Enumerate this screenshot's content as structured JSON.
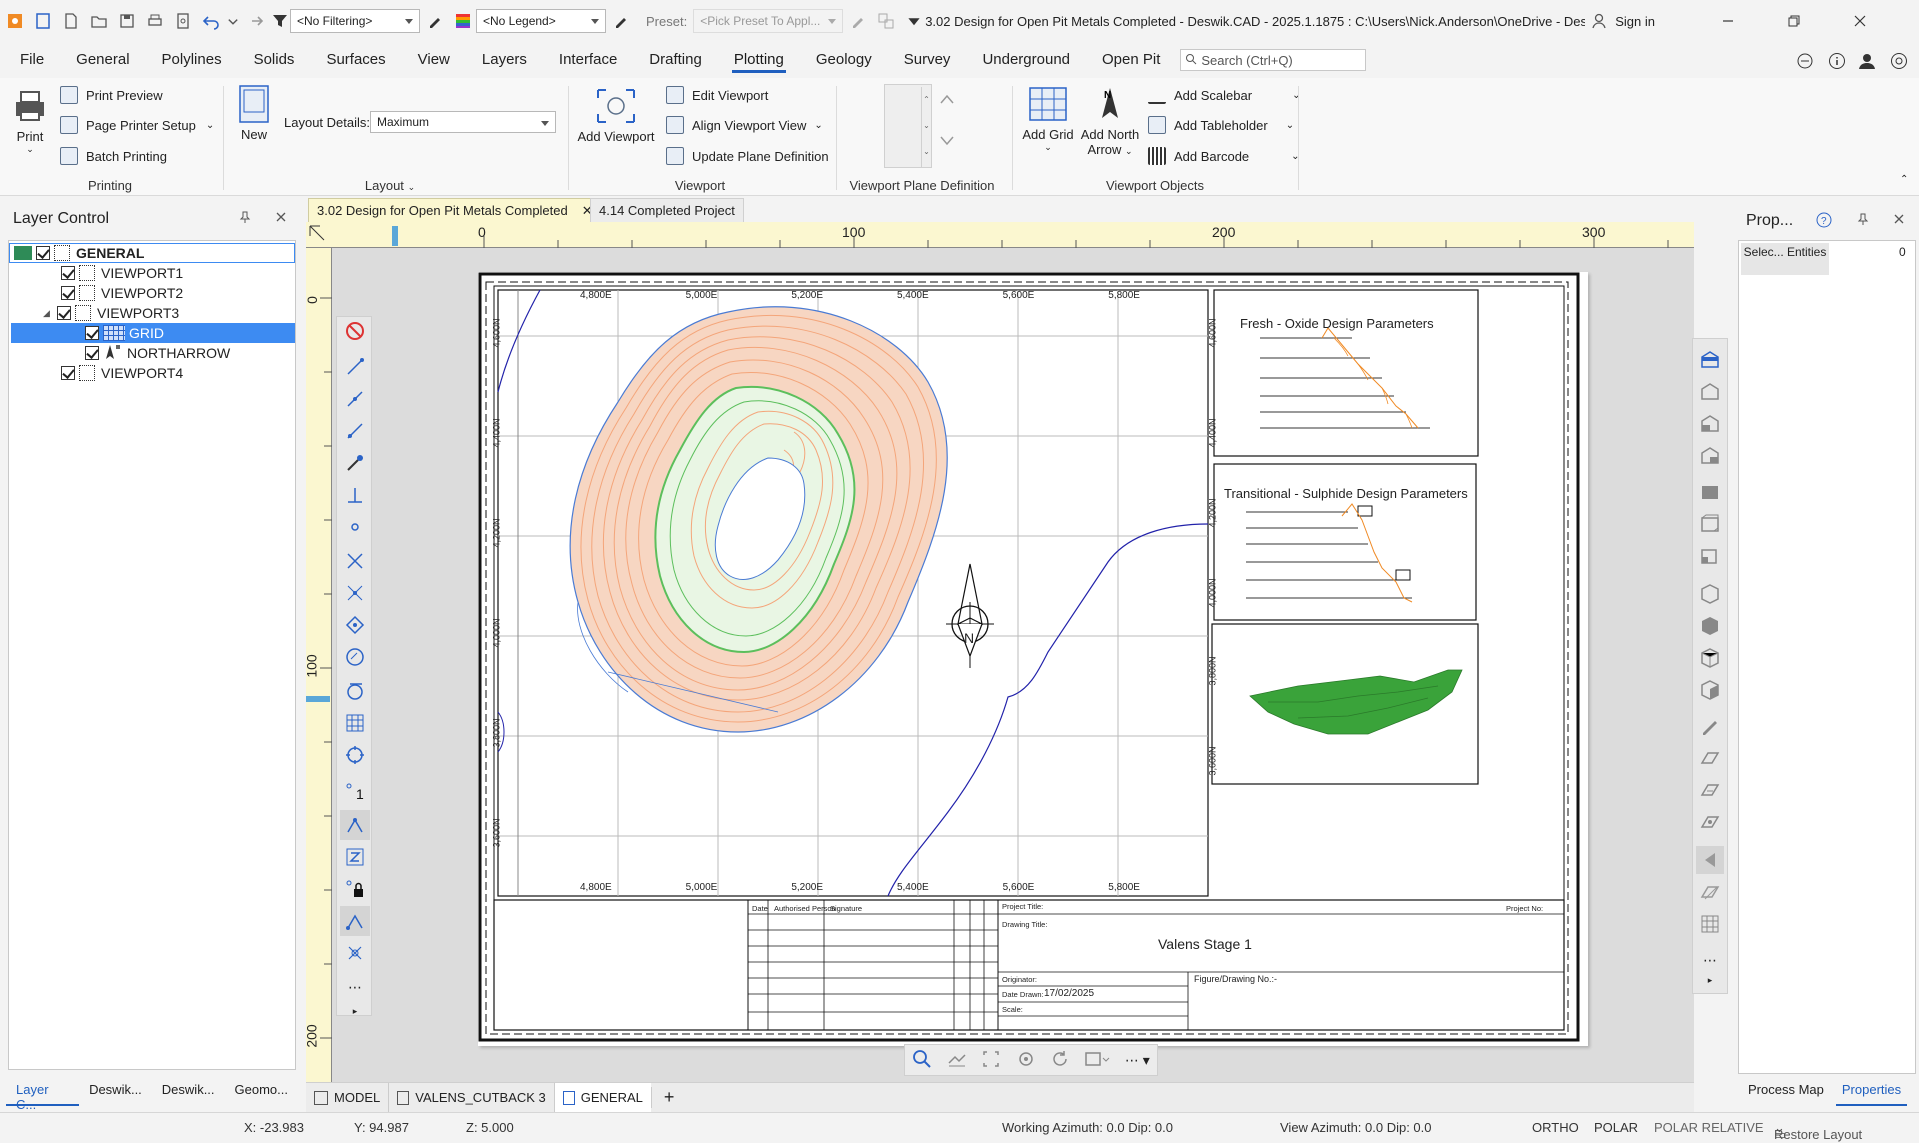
{
  "titlebar": {
    "filter": "<No Filtering>",
    "legend": "<No Legend>",
    "preset_label": "Preset:",
    "preset_value": "<Pick Preset To Appl...",
    "title": "3.02 Design for Open Pit Metals Completed - Deswik.CAD - 2025.1.1875 : C:\\Users\\Nick.Anderson\\OneDrive - Deswik...",
    "signin": "Sign in"
  },
  "menu": [
    "File",
    "General",
    "Polylines",
    "Solids",
    "Surfaces",
    "View",
    "Layers",
    "Interface",
    "Drafting",
    "Plotting",
    "Geology",
    "Survey",
    "Underground",
    "Open Pit"
  ],
  "menu_active": "Plotting",
  "search_placeholder": "Search (Ctrl+Q)",
  "ribbon": {
    "print": "Print",
    "print_preview": "Print Preview",
    "page_printer_setup": "Page Printer Setup",
    "batch_printing": "Batch Printing",
    "group_printing": "Printing",
    "new": "New",
    "layout_details_label": "Layout Details:",
    "layout_details_value": "Maximum",
    "group_layout": "Layout",
    "add_viewport": "Add Viewport",
    "edit_viewport": "Edit Viewport",
    "align_viewport_view": "Align Viewport View",
    "update_plane_definition": "Update Plane Definition",
    "group_viewport": "Viewport",
    "group_viewport_plane": "Viewport Plane Definition",
    "add_grid": "Add Grid",
    "add_north": "Add North",
    "arrow": "Arrow",
    "add_scalebar": "Add Scalebar",
    "add_tableholder": "Add Tableholder",
    "add_barcode": "Add Barcode",
    "group_viewport_objects": "Viewport Objects"
  },
  "layer_control": {
    "title": "Layer Control",
    "items": [
      {
        "label": "GENERAL",
        "level": 0,
        "bold": true
      },
      {
        "label": "VIEWPORT1",
        "level": 1
      },
      {
        "label": "VIEWPORT2",
        "level": 1
      },
      {
        "label": "VIEWPORT3",
        "level": 1
      },
      {
        "label": "GRID",
        "level": 2,
        "selected": true
      },
      {
        "label": "NORTHARROW",
        "level": 2
      },
      {
        "label": "VIEWPORT4",
        "level": 1
      }
    ],
    "bottom_tabs": [
      "Layer C...",
      "Deswik...",
      "Deswik...",
      "Geomo..."
    ]
  },
  "doc_tabs": [
    "3.02 Design for Open Pit Metals Completed",
    "4.14 Completed Project"
  ],
  "ruler": {
    "h_ticks": [
      "0",
      "100",
      "200",
      "300"
    ],
    "v_ticks": [
      "0",
      "100",
      "200"
    ]
  },
  "drawing": {
    "easting_labels": [
      "4,800E",
      "5,000E",
      "5,200E",
      "5,400E",
      "5,600E",
      "5,800E"
    ],
    "northing_labels": [
      "4,600N",
      "4,400N",
      "4,200N",
      "4,000N",
      "3,800N",
      "3,600N"
    ],
    "right_northing_labels": [
      "4,600N",
      "4,400N",
      "4,200N",
      "4,000N",
      "3,800N",
      "3,600N"
    ],
    "north_letter": "N",
    "panel1_title": "Fresh - Oxide Design Parameters",
    "panel2_title": "Transitional - Sulphide Design Parameters",
    "titleblock": {
      "date": "Date",
      "authorised": "Authorised Person",
      "signature": "Signature",
      "project_title": "Project Title:",
      "project_no": "Project No:",
      "drawing_title": "Drawing Title:",
      "drawing_title_value": "Valens Stage 1",
      "originator": "Originator:",
      "date_drawn": "Date Drawn:",
      "date_drawn_value": "17/02/2025",
      "scale": "Scale:",
      "figure_no": "Figure/Drawing No.:-"
    }
  },
  "bottom_tabs": [
    "MODEL",
    "VALENS_CUTBACK 3",
    "GENERAL"
  ],
  "properties": {
    "title": "Prop...",
    "col1": "Selec... Entities",
    "col2": "0",
    "bottom_tabs": [
      "Process Map",
      "Properties"
    ]
  },
  "status": {
    "x": "X: -23.983",
    "y": "Y: 94.987",
    "z": "Z: 5.000",
    "working_azimuth": "Working Azimuth: 0.0 Dip: 0.0",
    "view_azimuth": "View Azimuth: 0.0 Dip: 0.0",
    "ortho": "ORTHO",
    "polar": "POLAR",
    "polar_relative": "POLAR RELATIVE",
    "restore_layout": "Restore Layout"
  },
  "colors": {
    "accent": "#1f5fbf",
    "selected": "#3d8bf2",
    "ruler": "#fbf7d0",
    "pit_orange": "#f4a57a",
    "pit_blue": "#4a7bd4",
    "berm_green": "#5cbf5c",
    "solid_green": "#3aa33a"
  }
}
